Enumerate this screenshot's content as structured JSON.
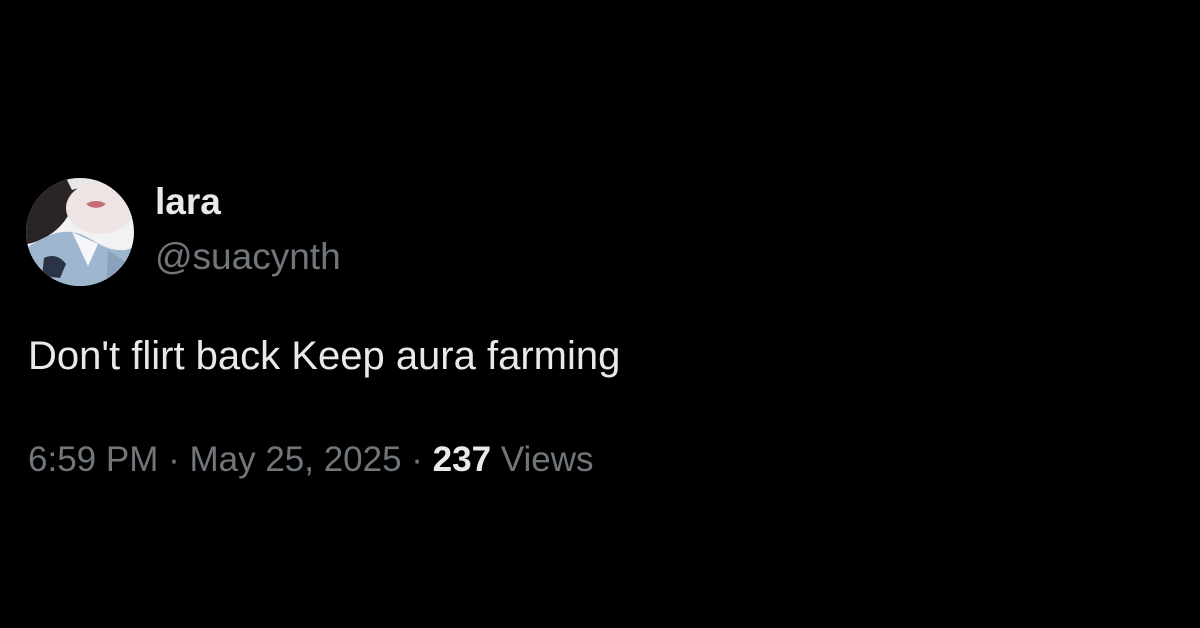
{
  "user": {
    "display_name": "lara",
    "handle": "@suacynth",
    "avatar_icon": "profile-photo"
  },
  "post": {
    "text": "Don't flirt back Keep aura farming",
    "time": "6:59 PM",
    "separator": " · ",
    "date": "May 25, 2025",
    "view_count": "237",
    "views_label": "Views"
  },
  "colors": {
    "background": "#000000",
    "primary_text": "#e7e9ea",
    "secondary_text": "#71767b"
  }
}
